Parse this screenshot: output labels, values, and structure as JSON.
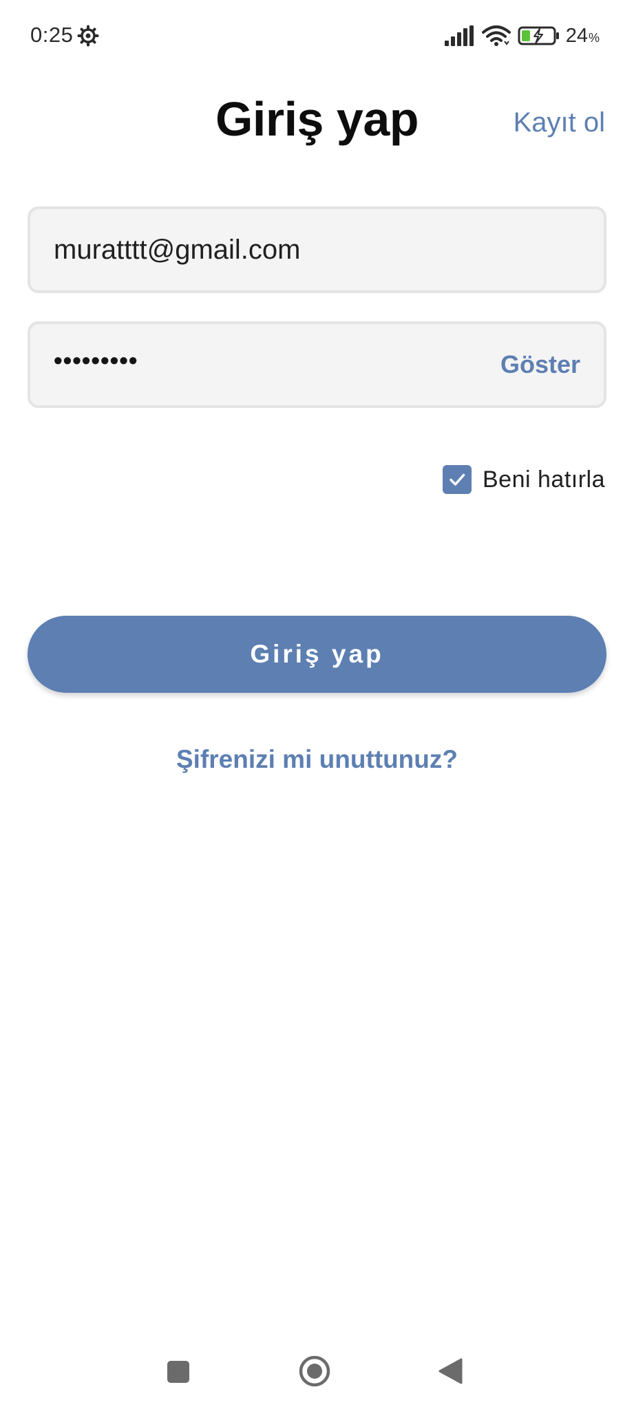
{
  "status_bar": {
    "time": "0:25",
    "battery_level": "24",
    "battery_unit": "%",
    "icons": [
      "gear-icon",
      "signal-icon",
      "wifi-icon",
      "battery-charging-icon"
    ]
  },
  "header": {
    "title": "Giriş yap",
    "register_label": "Kayıt ol"
  },
  "form": {
    "email_value": "muratttt@gmail.com",
    "password_masked": "•••••••••",
    "show_label": "Göster",
    "remember_label": "Beni hatırla",
    "remember_checked": true,
    "submit_label": "Giriş yap",
    "forgot_label": "Şifrenizi mi unuttunuz?"
  },
  "navigation": {
    "icons": [
      "recents-icon",
      "home-icon",
      "back-icon"
    ]
  },
  "colors": {
    "accent": "#5d7fb2",
    "field_background": "#f4f4f4",
    "field_border": "#e4e4e4",
    "title_text": "#0d0d0d"
  }
}
